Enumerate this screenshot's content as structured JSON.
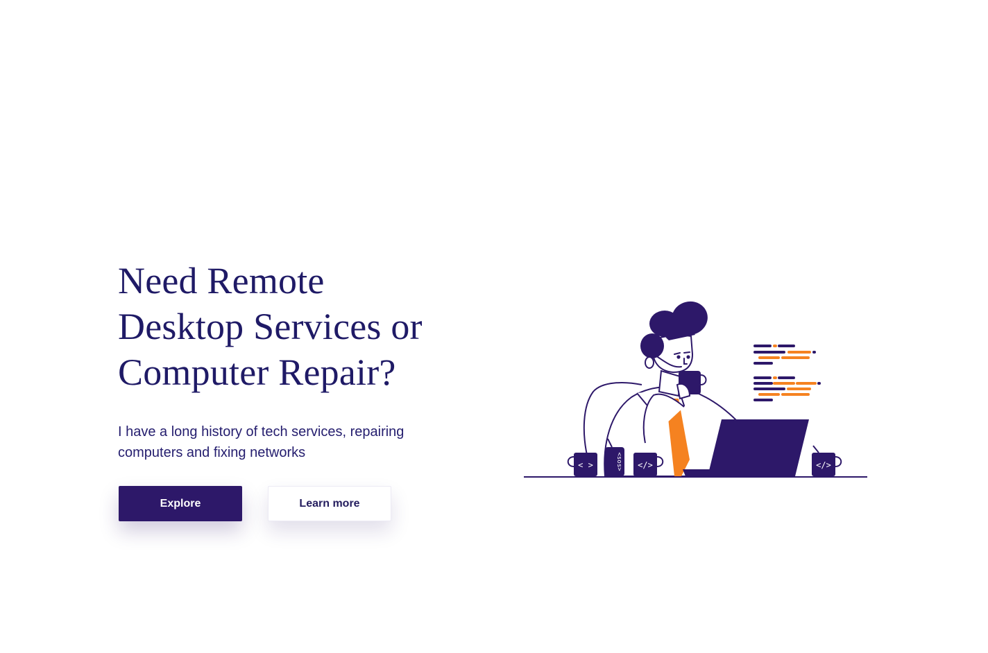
{
  "hero": {
    "title": "Need Remote Desktop Services or Computer Repair?",
    "subtitle": "I have a long history of tech services, repairing computers and fixing networks"
  },
  "actions": {
    "explore_label": "Explore",
    "learn_more_label": "Learn more"
  },
  "illustration": {
    "mug_left_label": "< >",
    "can_label": "<sos>",
    "mug_middle_label": "</>",
    "mug_right_label": "</>"
  },
  "colors": {
    "brand": "#2d1869",
    "heading": "#1f1a66",
    "accent": "#f58220",
    "background": "#ffffff"
  }
}
